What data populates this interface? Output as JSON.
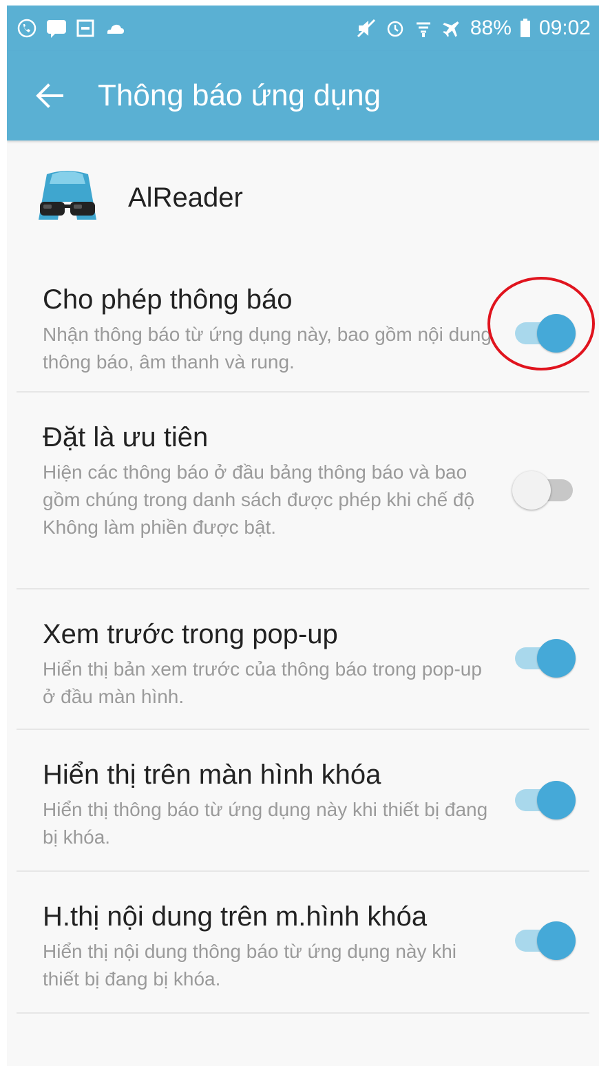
{
  "status_bar": {
    "battery": "88%",
    "time": "09:02",
    "left_icons": [
      "phone-icon",
      "chat-icon",
      "gallery-icon",
      "cloud-icon"
    ],
    "right_icons": [
      "mute-icon",
      "alarm-icon",
      "signal-icon",
      "airplane-icon",
      "battery-icon"
    ]
  },
  "app_bar": {
    "title": "Thông báo ứng dụng",
    "back_icon": "back-arrow-icon"
  },
  "app": {
    "name": "AlReader",
    "icon": "alreader-icon"
  },
  "settings": [
    {
      "title": "Cho phép thông báo",
      "description": "Nhận thông báo từ ứng dụng này, bao gồm nội dung thông báo, âm thanh và rung.",
      "enabled": true
    },
    {
      "title": "Đặt là ưu tiên",
      "description": "Hiện các thông báo ở đầu bảng thông báo và bao gồm chúng trong danh sách được phép khi chế độ Không làm phiền được bật.",
      "enabled": false
    },
    {
      "title": "Xem trước trong pop-up",
      "description": "Hiển thị bản xem trước của thông báo trong pop-up ở đầu màn hình.",
      "enabled": true
    },
    {
      "title": "Hiển thị trên màn hình khóa",
      "description": "Hiển thị thông báo từ ứng dụng này khi thiết bị đang bị khóa.",
      "enabled": true
    },
    {
      "title": "H.thị nội dung trên m.hình khóa",
      "description": "Hiển thị nội dung thông báo từ ứng dụng này khi thiết bị đang bị khóa.",
      "enabled": true
    }
  ],
  "colors": {
    "primary": "#5ab0d3",
    "toggle_on": "#45a9d8",
    "highlight": "#e0141e"
  }
}
